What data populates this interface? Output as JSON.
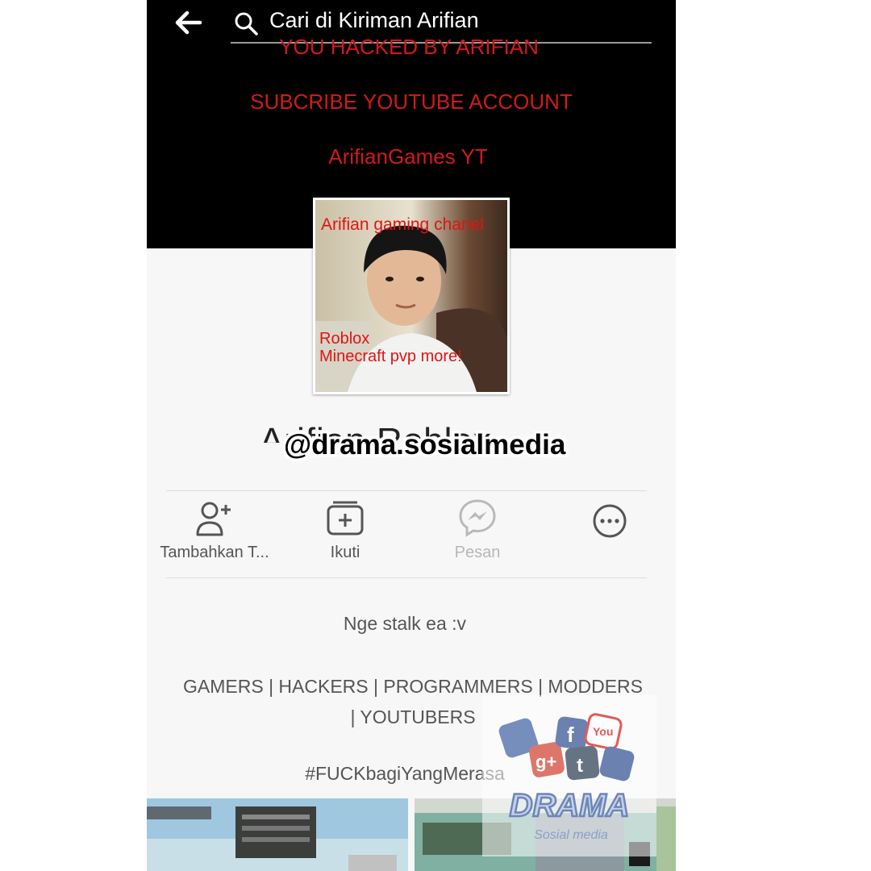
{
  "header": {
    "back_icon": "arrow-left-icon",
    "search_icon": "search-icon",
    "search_placeholder": "Cari di Kiriman Arifian"
  },
  "cover": {
    "line1": "YOU HACKED BY ARIFIAN",
    "line2": "SUBCRIBE YOUTUBE ACCOUNT",
    "line3": "ArifianGames YT"
  },
  "profile_picture": {
    "caption_top": "Arifian gaming chanel",
    "caption_bottom_1": "Roblox",
    "caption_bottom_2": "Minecraft pvp more!"
  },
  "profile": {
    "name": "Arifian Roblox",
    "watermark": "@drama.sosialmedia"
  },
  "actions": [
    {
      "label": "Tambahkan T...",
      "icon": "add-friend-icon",
      "enabled": true
    },
    {
      "label": "Ikuti",
      "icon": "follow-icon",
      "enabled": true
    },
    {
      "label": "Pesan",
      "icon": "messenger-icon",
      "enabled": false
    },
    {
      "label": "",
      "icon": "more-icon",
      "enabled": true
    }
  ],
  "bio": {
    "intro": "Nge stalk ea :v",
    "tags": "GAMERS | HACKERS | PROGRAMMERS | MODDERS | YOUTUBERS",
    "hashtag": "#FUCKbagiYangMerasa"
  },
  "logo": {
    "title": "DRAMA",
    "subtitle": "Sosial media",
    "badge_text": "You"
  },
  "colors": {
    "cover_bg": "#000000",
    "cover_text": "#d11a1a",
    "body_bg": "#f7f7f7",
    "muted_text": "#555555",
    "disabled_text": "#b7b7b7"
  }
}
